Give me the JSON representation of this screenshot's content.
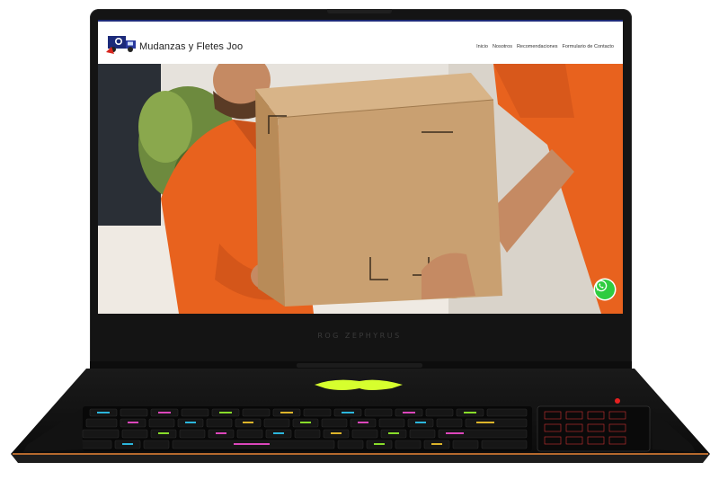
{
  "site": {
    "brand": "Mudanzas y Fletes Joo",
    "nav": [
      "Inicio",
      "Nosotros",
      "Recomendaciones",
      "Formulario de Contacto"
    ]
  },
  "laptop": {
    "bezel_label": "ROG ZEPHYRUS"
  },
  "icons": {
    "logo": "moving-truck-logo",
    "contact": "whatsapp-icon"
  },
  "colors": {
    "header_accent": "#1e2a78",
    "uniform_orange": "#e8621e",
    "box_cardboard": "#c9a071",
    "whatsapp_green": "#2ecc40",
    "keyboard_glow": "#d6ff2e"
  }
}
